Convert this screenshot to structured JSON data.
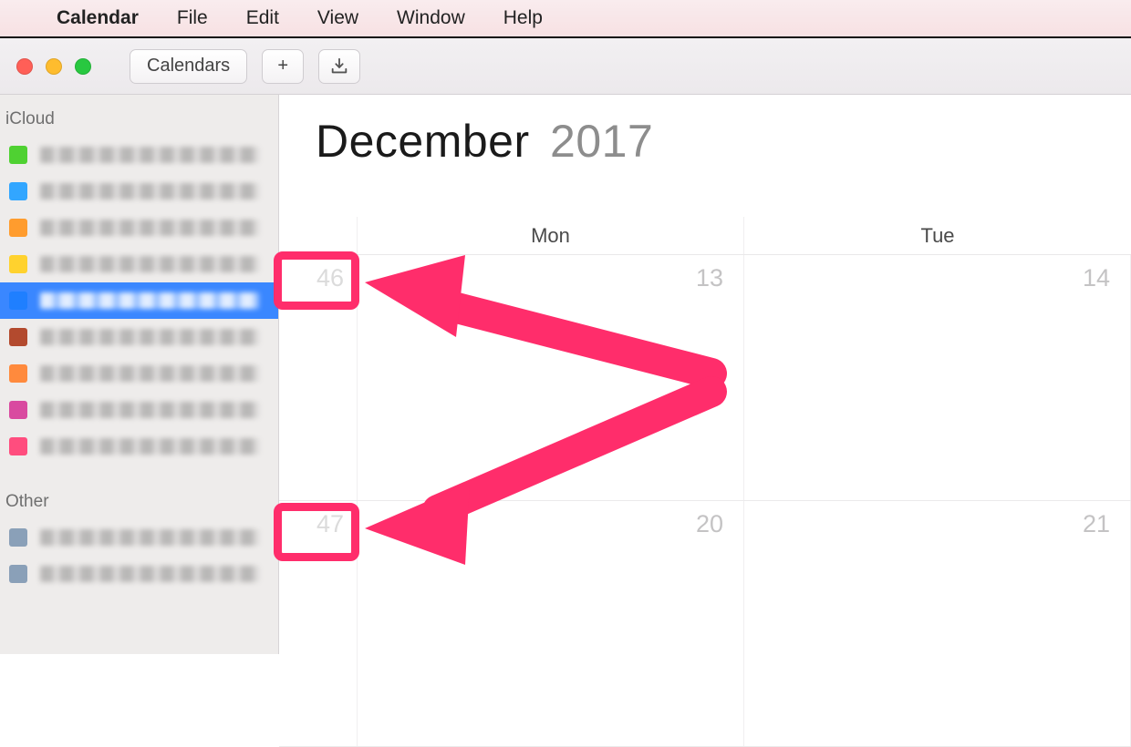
{
  "menubar": {
    "app_name": "Calendar",
    "items": [
      "File",
      "Edit",
      "View",
      "Window",
      "Help"
    ]
  },
  "toolbar": {
    "calendars_label": "Calendars",
    "add_label": "+",
    "inbox_icon_name": "inbox-tray-icon"
  },
  "sidebar": {
    "sections": [
      {
        "title": "iCloud",
        "items": [
          {
            "color": "#4fd132",
            "selected": false
          },
          {
            "color": "#32a6ff",
            "selected": false
          },
          {
            "color": "#ff9c2e",
            "selected": false
          },
          {
            "color": "#ffd22e",
            "selected": false
          },
          {
            "color": "#1f7fff",
            "selected": true
          },
          {
            "color": "#b34a2e",
            "selected": false
          },
          {
            "color": "#ff8a3d",
            "selected": false
          },
          {
            "color": "#d94aa0",
            "selected": false
          },
          {
            "color": "#ff4d7e",
            "selected": false
          }
        ]
      },
      {
        "title": "Other",
        "items": [
          {
            "color": "#8aa0b8",
            "selected": false
          },
          {
            "color": "#8aa0b8",
            "selected": false
          }
        ]
      }
    ]
  },
  "calendar": {
    "month_label": "December",
    "year_label": "2017",
    "day_headers": [
      "Mon",
      "Tue"
    ],
    "rows": [
      {
        "week_number": "46",
        "days": [
          "13",
          "14"
        ]
      },
      {
        "week_number": "47",
        "days": [
          "20",
          "21"
        ]
      }
    ]
  },
  "annotations": {
    "highlight_color": "#ff2d6b",
    "box_targets": [
      "46",
      "47"
    ]
  }
}
